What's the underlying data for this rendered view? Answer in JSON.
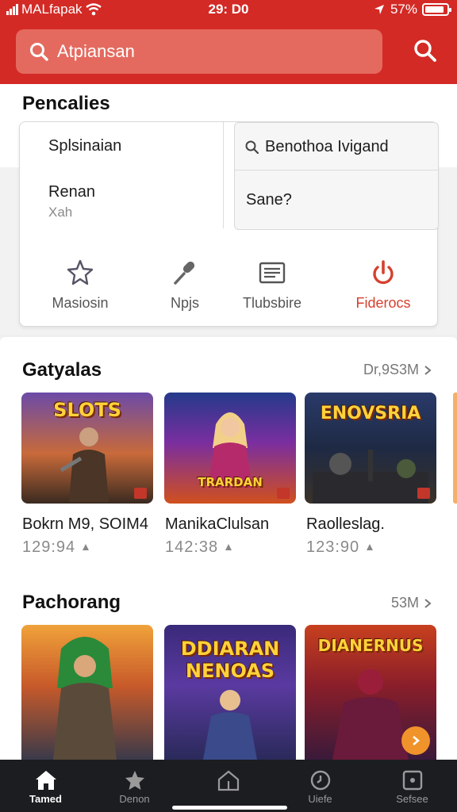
{
  "status": {
    "carrier": "MALfapak",
    "time": "29: D0",
    "battery_text": "57%",
    "battery_level": 0.9
  },
  "search": {
    "placeholder": "Atpiansan",
    "icon": "search-icon"
  },
  "top_section": {
    "title": "Pencalies",
    "left_items": [
      {
        "label": "Splsinaian"
      },
      {
        "label": "Renan",
        "sub": "Xah"
      }
    ],
    "right_items": [
      {
        "label": "Benothoa Ivigand",
        "icon": "search-icon"
      },
      {
        "label": "Sane?"
      }
    ],
    "actions": [
      {
        "label": "Masiosin",
        "icon": "star-icon"
      },
      {
        "label": "Npjs",
        "icon": "microphone-icon"
      },
      {
        "label": "Tlubsbire",
        "icon": "newspaper-icon"
      },
      {
        "label": "Fiderocs",
        "icon": "power-icon",
        "active": true
      }
    ]
  },
  "sections": [
    {
      "title": "Gatyalas",
      "more": "Dr,9S3M",
      "items": [
        {
          "name": "Bokrn M9, SOIM4",
          "meta": "129:94",
          "poster_title": "SLOTS"
        },
        {
          "name": "ManikaClulsan",
          "meta": "142:38",
          "poster_title": "TRARDAN"
        },
        {
          "name": "Raolleslag.",
          "meta": "123:90",
          "poster_title": "ENOVSRIA"
        }
      ]
    },
    {
      "title": "Pachorang",
      "more": "53M",
      "items": [
        {
          "poster_title": ""
        },
        {
          "poster_title": "DDIARAN NENOAS"
        },
        {
          "poster_title": "DIANERNUS"
        }
      ]
    }
  ],
  "bottom_nav": [
    {
      "label": "Tamed",
      "icon": "home-icon",
      "active": true
    },
    {
      "label": "Denon",
      "icon": "star-icon"
    },
    {
      "label": "",
      "icon": "house-outline-icon"
    },
    {
      "label": "Uiefe",
      "icon": "clock-icon"
    },
    {
      "label": "Sefsee",
      "icon": "square-icon"
    }
  ],
  "colors": {
    "brand": "#d32a26",
    "accent_active": "#d6402e",
    "nav_bg": "#1b1d21"
  }
}
